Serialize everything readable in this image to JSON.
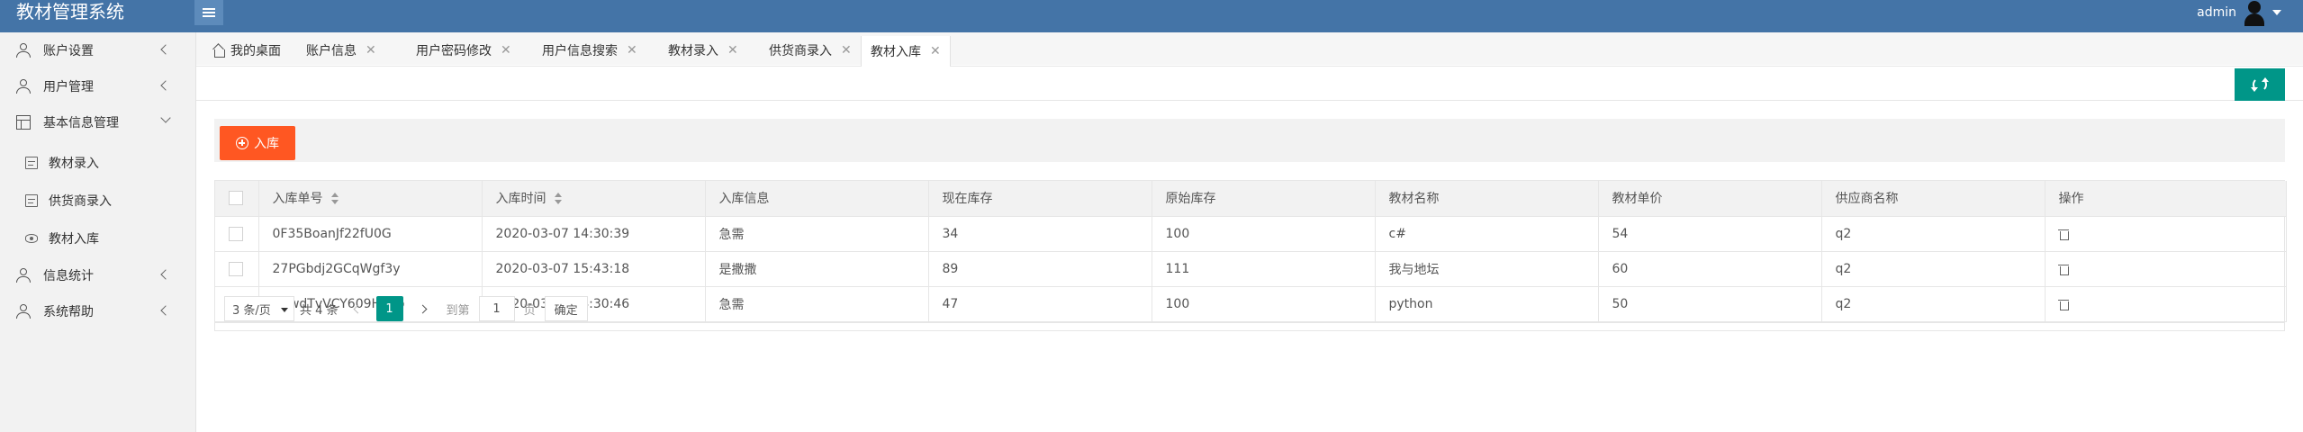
{
  "header": {
    "logo": "教材管理系统",
    "user_name": "admin"
  },
  "sidebar": {
    "items": [
      {
        "label": "账户设置"
      },
      {
        "label": "用户管理"
      },
      {
        "label": "基本信息管理"
      },
      {
        "label": "教材录入"
      },
      {
        "label": "供货商录入"
      },
      {
        "label": "教材入库"
      },
      {
        "label": "信息统计"
      },
      {
        "label": "系统帮助"
      }
    ]
  },
  "tabs": [
    {
      "label": "我的桌面"
    },
    {
      "label": "账户信息"
    },
    {
      "label": "用户密码修改"
    },
    {
      "label": "用户信息搜索"
    },
    {
      "label": "教材录入"
    },
    {
      "label": "供货商录入"
    },
    {
      "label": "教材入库"
    }
  ],
  "toolbar": {
    "add_label": "入库"
  },
  "table": {
    "headers": [
      "入库单号",
      "入库时间",
      "入库信息",
      "现在库存",
      "原始库存",
      "教材名称",
      "教材单价",
      "供应商名称",
      "操作"
    ],
    "rows": [
      [
        "0F35BoanJf22fU0G",
        "2020-03-07 14:30:39",
        "急需",
        "34",
        "100",
        "c#",
        "54",
        "q2"
      ],
      [
        "27PGbdj2GCqWgf3y",
        "2020-03-07 15:43:18",
        "是撒撒",
        "89",
        "111",
        "我与地坛",
        "60",
        "q2"
      ],
      [
        "qVwdTvVCY609HUFo",
        "2020-03-07 14:30:46",
        "急需",
        "47",
        "100",
        "python",
        "50",
        "q2"
      ]
    ]
  },
  "pager": {
    "page_size": "3 条/页",
    "total": "共 4 条",
    "current": "1",
    "goto_label": "到第",
    "goto_value": "1",
    "page_label": "页",
    "confirm": "确定"
  },
  "colors": {
    "header_bg": "#4474a7",
    "accent_green": "#009688",
    "accent_orange": "#ff5722"
  }
}
